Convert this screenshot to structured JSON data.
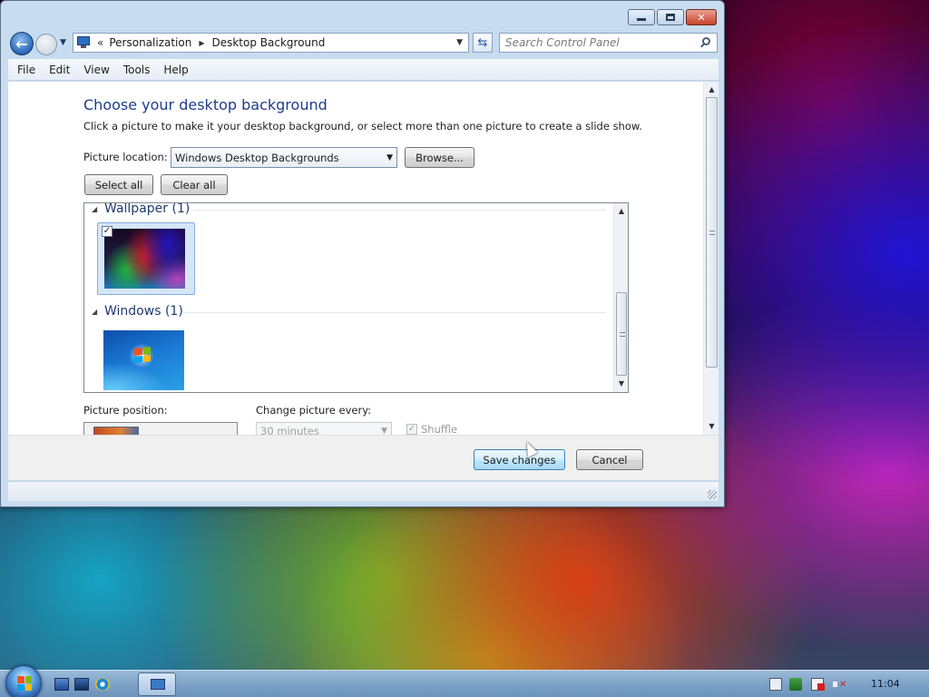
{
  "window": {
    "address": {
      "crumbs": [
        "Personalization",
        "Desktop Background"
      ]
    },
    "search": {
      "placeholder": "Search Control Panel"
    },
    "menu": [
      "File",
      "Edit",
      "View",
      "Tools",
      "Help"
    ]
  },
  "page": {
    "title": "Choose your desktop background",
    "description": "Click a picture to make it your desktop background, or select more than one picture to create a slide show.",
    "picture_location_label": "Picture location:",
    "picture_location_value": "Windows Desktop Backgrounds",
    "browse_label": "Browse...",
    "select_all_label": "Select all",
    "clear_all_label": "Clear all",
    "groups": [
      {
        "title": "Wallpaper (1)",
        "items": [
          {
            "checked": true,
            "selected": true
          }
        ]
      },
      {
        "title": "Windows (1)",
        "items": [
          {
            "checked": false,
            "selected": false
          }
        ]
      }
    ],
    "picture_position_label": "Picture position:",
    "change_every_label": "Change picture every:",
    "interval_value": "30 minutes",
    "shuffle_label": "Shuffle",
    "shuffle_checked": true
  },
  "footer": {
    "save_label": "Save changes",
    "cancel_label": "Cancel"
  },
  "taskbar": {
    "clock": "11:04"
  }
}
